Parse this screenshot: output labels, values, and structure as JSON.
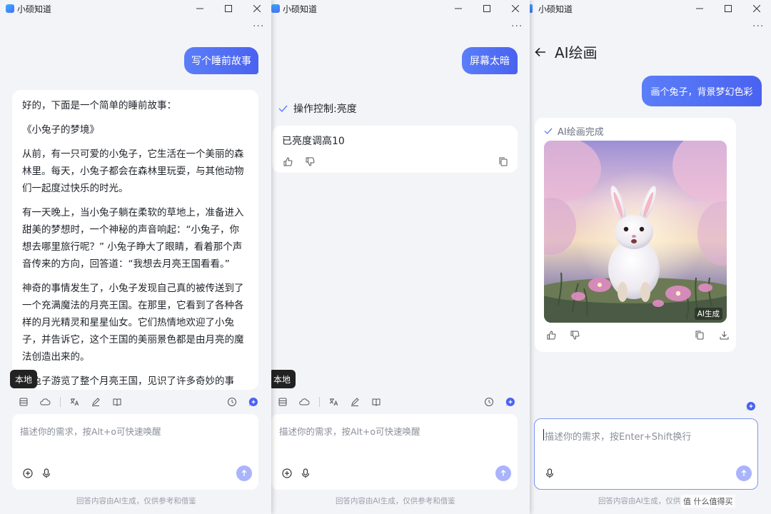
{
  "app_name": "小硕知道",
  "window_controls": {
    "minimize": "minimize-icon",
    "maximize": "maximize-icon",
    "close": "close-icon"
  },
  "colors": {
    "accent": "#4a62f0",
    "send_disabled": "#a9b4fb",
    "background": "#f3f4f8",
    "tooltip": "#222222"
  },
  "input_tools": [
    "local-icon",
    "cloud-icon",
    "translate-icon",
    "edit-icon",
    "book-icon",
    "history-icon",
    "new-chat-icon"
  ],
  "tooltip": "本地",
  "footer": "回答内容由AI生成，仅供参考和借鉴",
  "input_placeholder": "描述你的需求，按Alt+o可快速唤醒",
  "left": {
    "user_message": "写个睡前故事",
    "story": [
      "好的，下面是一个简单的睡前故事：",
      "《小兔子的梦境》",
      "从前，有一只可爱的小兔子，它生活在一个美丽的森林里。每天，小兔子都会在森林里玩耍，与其他动物们一起度过快乐的时光。",
      "有一天晚上，当小兔子躺在柔软的草地上，准备进入甜美的梦想时，一个神秘的声音响起：“小兔子，你想去哪里旅行呢？” 小兔子睁大了眼睛，看着那个声音传来的方向，回答道：“我想去月亮王国看看。”",
      "神奇的事情发生了，小兔子发现自己真的被传送到了一个充满魔法的月亮王国。在那里，它看到了各种各样的月光精灵和星星仙女。它们热情地欢迎了小兔子，并告诉它，这个王国的美丽景色都是由月亮的魔法创造出来的。",
      "小兔子游览了整个月亮王国，见识了许多奇妙的事物。"
    ]
  },
  "middle": {
    "user_message": "屏幕太暗",
    "status": "操作控制:亮度",
    "reply": "已亮度调高10"
  },
  "right": {
    "header_title": "AI绘画",
    "user_message": "画个兔子，背景梦幻色彩",
    "status": "AI绘画完成",
    "image_badge": "AI生成",
    "input_placeholder": "描述你的需求，按Enter+Shift换行",
    "footer_visible": "回答内容由AI生成，仅供",
    "watermark": "值 什么值得买"
  }
}
